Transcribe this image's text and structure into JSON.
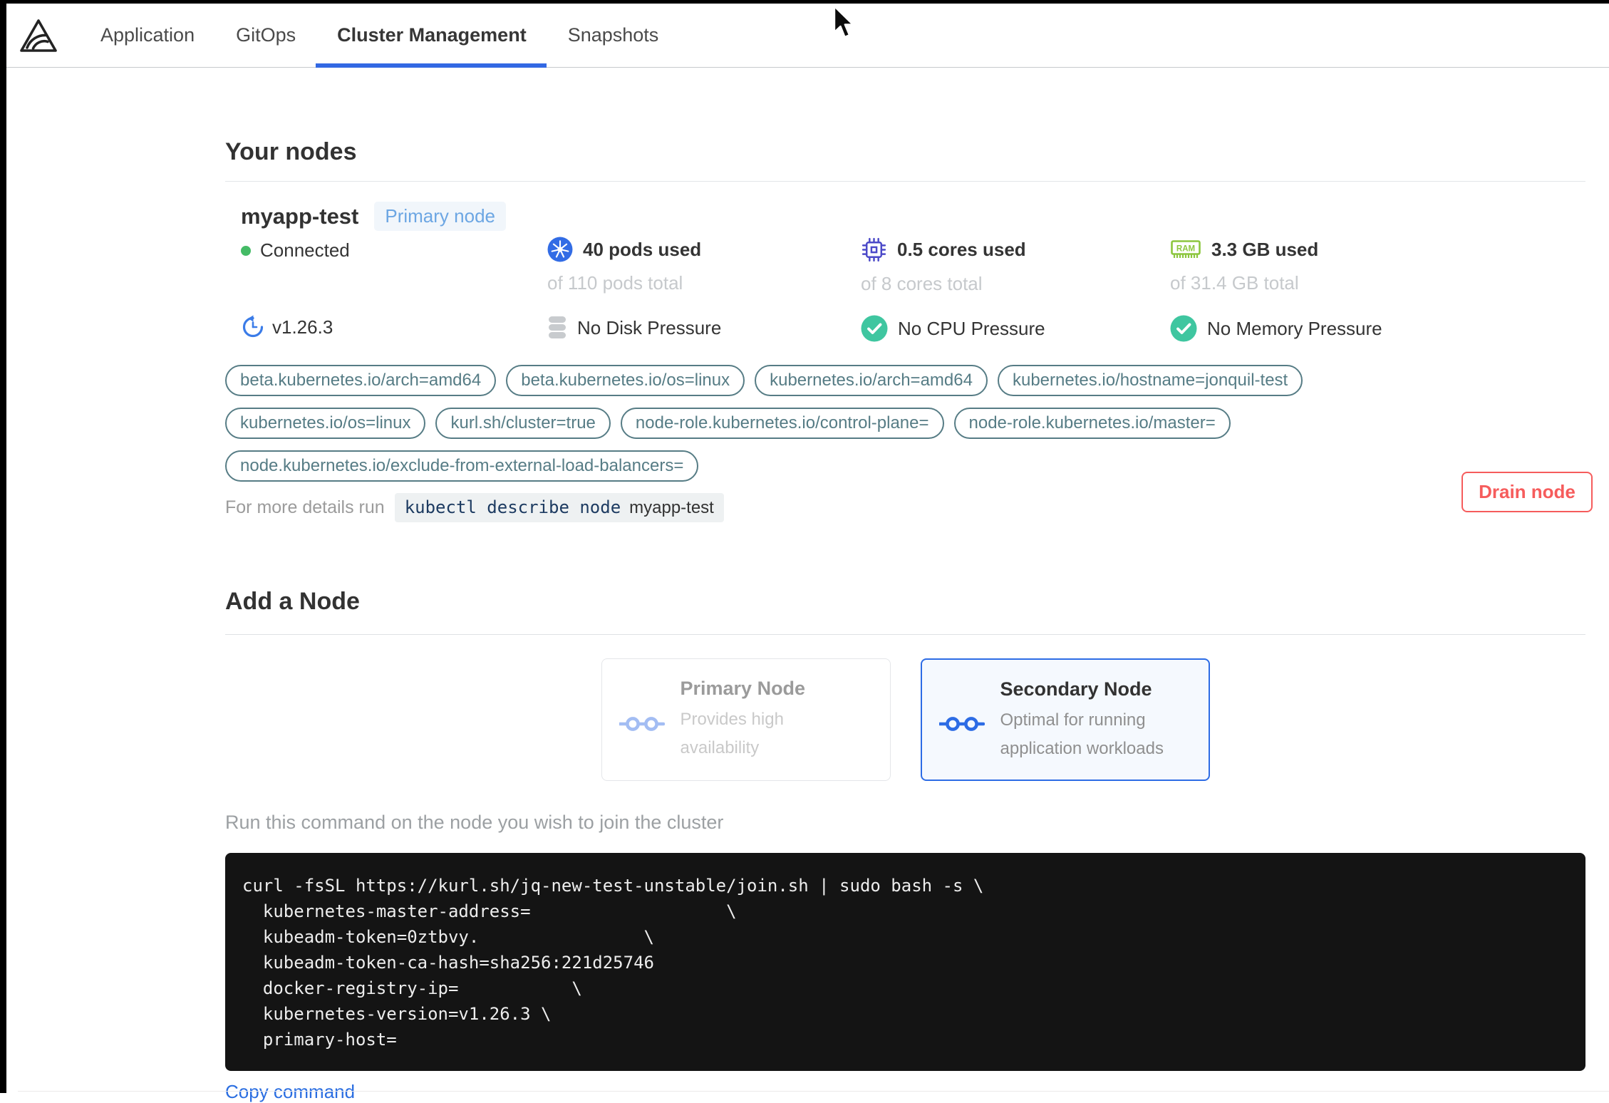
{
  "nav": {
    "logo": "replicated-logo",
    "tabs": [
      {
        "label": "Application",
        "active": false
      },
      {
        "label": "GitOps",
        "active": false
      },
      {
        "label": "Cluster Management",
        "active": true
      },
      {
        "label": "Snapshots",
        "active": false
      }
    ]
  },
  "your_nodes": {
    "heading": "Your nodes",
    "node": {
      "name": "myapp-test",
      "badge": "Primary node",
      "status": "Connected",
      "version": "v1.26.3",
      "version_icon": "reset-clock-icon",
      "stats": [
        {
          "icon": "kubernetes-icon",
          "used": "40 pods used",
          "total": "of 110 pods total"
        },
        {
          "icon": "cpu-icon",
          "used": "0.5 cores used",
          "total": "of 8 cores total"
        },
        {
          "icon": "ram-icon",
          "used": "3.3 GB used",
          "total": "of 31.4 GB total"
        }
      ],
      "conditions": [
        {
          "icon": "disk-icon",
          "label": "No Disk Pressure"
        },
        {
          "icon": "check-icon",
          "label": "No CPU Pressure"
        },
        {
          "icon": "check-icon",
          "label": "No Memory Pressure"
        }
      ],
      "label_rows": [
        [
          "beta.kubernetes.io/arch=amd64",
          "beta.kubernetes.io/os=linux",
          "kubernetes.io/arch=amd64",
          "kubernetes.io/hostname=jonquil-test"
        ],
        [
          "kubernetes.io/os=linux",
          "kurl.sh/cluster=true",
          "node-role.kubernetes.io/control-plane=",
          "node-role.kubernetes.io/master="
        ],
        [
          "node.kubernetes.io/exclude-from-external-load-balancers="
        ]
      ],
      "details_hint": "For more details run",
      "details_command": "kubectl describe node",
      "details_node": "myapp-test",
      "drain_button": "Drain node"
    }
  },
  "add_node": {
    "heading": "Add a Node",
    "options": [
      {
        "icon": "node-link-icon",
        "title": "Primary Node",
        "description": "Provides high availability",
        "selected": false
      },
      {
        "icon": "node-link-icon",
        "title": "Secondary Node",
        "description": "Optimal for running application workloads",
        "selected": true
      }
    ],
    "instruction": "Run this command on the node you wish to join the cluster",
    "command_lines": [
      "curl -fsSL https://kurl.sh/jq-new-test-unstable/join.sh | sudo bash -s \\",
      "  kubernetes-master-address=                   \\",
      "  kubeadm-token=0ztbvy.                \\",
      "  kubeadm-token-ca-hash=sha256:221d25746",
      "  docker-registry-ip=           \\",
      "  kubernetes-version=v1.26.3 \\",
      "  primary-host="
    ],
    "copy_link": "Copy command"
  },
  "colors": {
    "accent_blue": "#3268e3",
    "link_blue": "#2b6ee1",
    "danger_red": "#f65c5c",
    "pill_teal": "#567c85",
    "kubernetes_blue": "#326ce5",
    "cpu_indigo": "#4b49c8",
    "ram_green": "#8cc63e",
    "success_green": "#3fc6a0",
    "connected_green": "#44bb66",
    "badge_text": "#6ca6e3",
    "badge_bg": "#f1f6fb"
  }
}
